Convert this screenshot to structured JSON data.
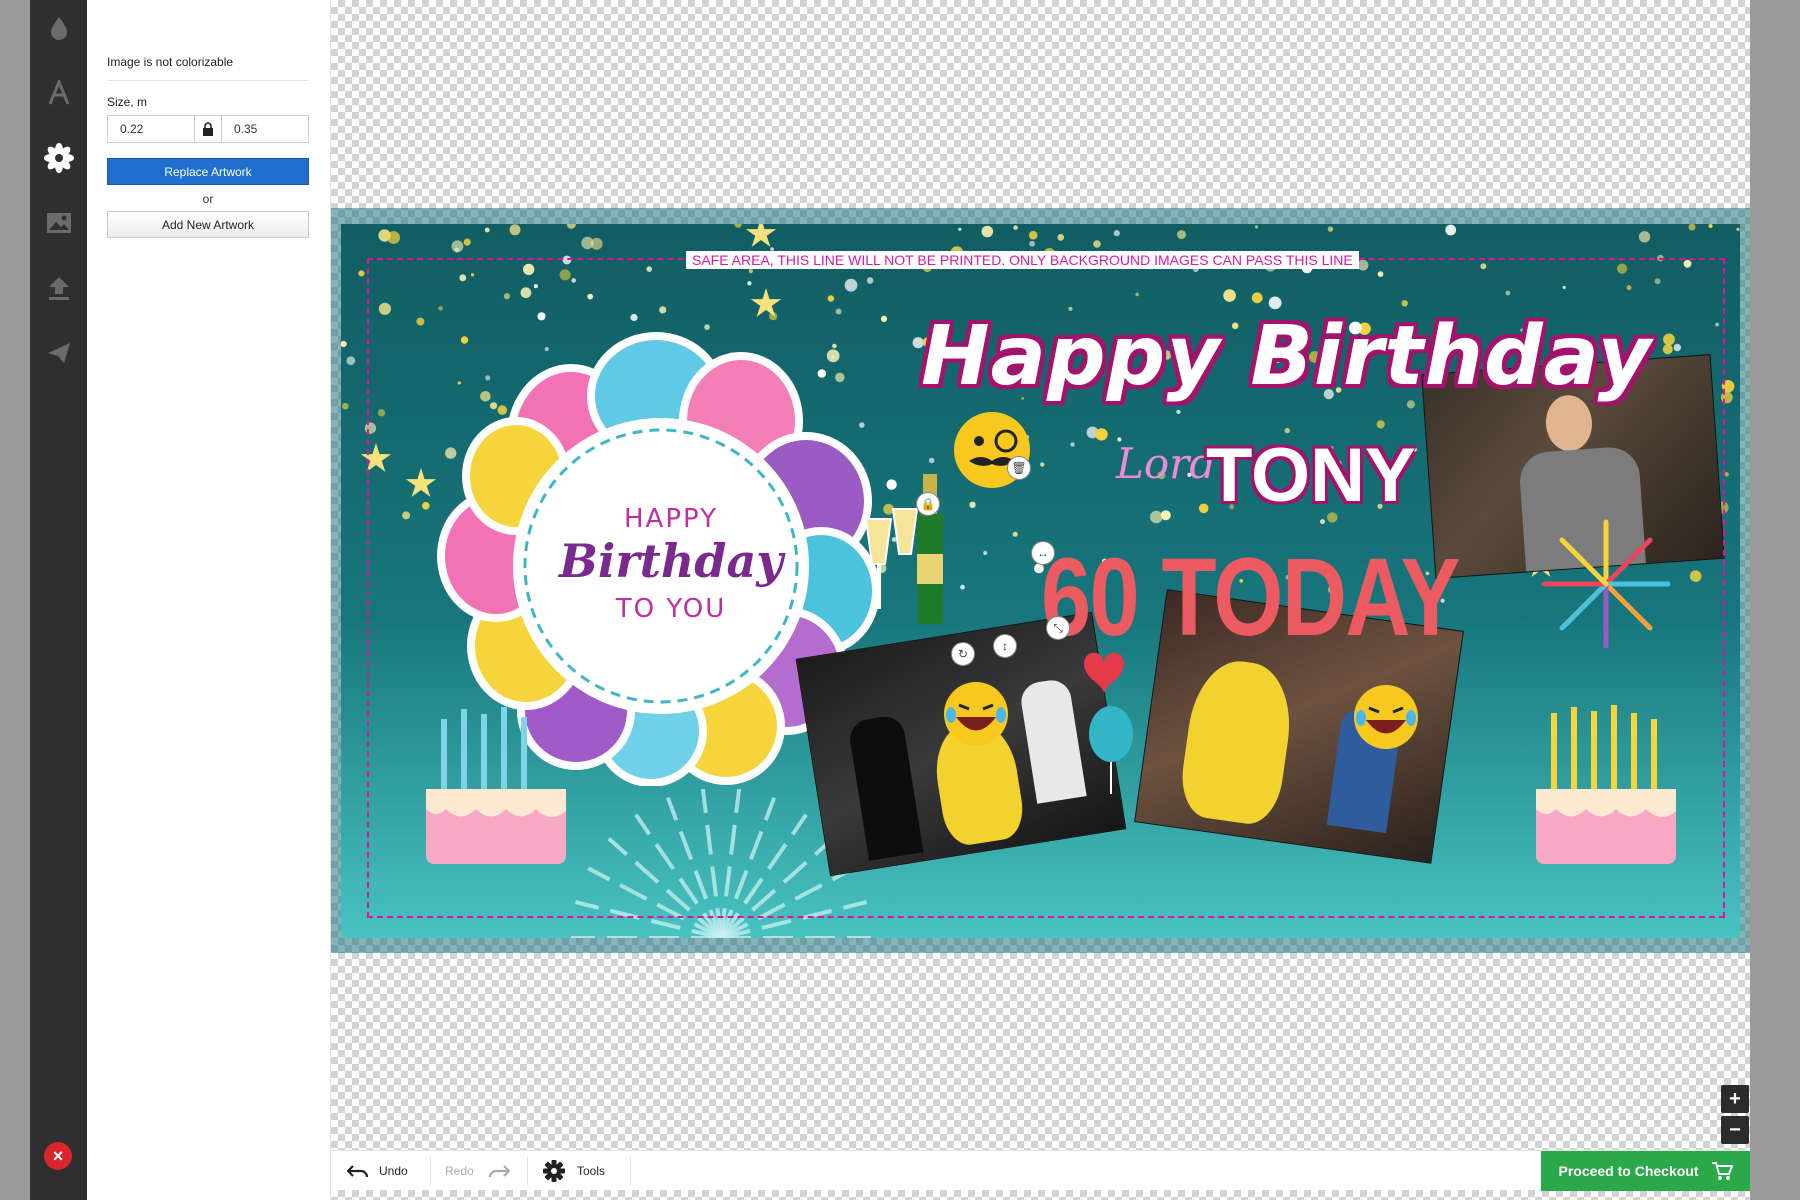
{
  "panel": {
    "note": "Image is not colorizable",
    "size_label": "Size, m",
    "width_value": "0.22",
    "height_value": "0.35",
    "replace_label": "Replace Artwork",
    "or_label": "or",
    "add_label": "Add New Artwork"
  },
  "toolbar": {
    "tools": [
      "droplet-icon",
      "text-icon",
      "flower-icon",
      "image-icon",
      "upload-icon",
      "send-icon"
    ],
    "active": "flower-icon",
    "close_icon": "close-icon"
  },
  "banner": {
    "safe_area_text": "SAFE AREA, THIS LINE WILL NOT BE PRINTED. ONLY BACKGROUND IMAGES CAN PASS THIS LINE",
    "headline": "Happy Birthday",
    "lord": "Lord",
    "name": "TONY",
    "age_text": "60 TODAY",
    "balloon_happy": "HAPPY",
    "balloon_birthday": "Birthday",
    "balloon_to_you": "TO YOU"
  },
  "bottom_bar": {
    "undo_label": "Undo",
    "redo_label": "Redo",
    "tools_label": "Tools",
    "checkout_label": "Proceed to Checkout"
  },
  "zoom": {
    "in_label": "+",
    "out_label": "−"
  },
  "colors": {
    "accent_blue": "#1f6fd1",
    "checkout_green": "#2aa84a",
    "safe_line": "#e0119f",
    "banner_teal": "#17767c",
    "sixty_today": "#ec5a62"
  }
}
